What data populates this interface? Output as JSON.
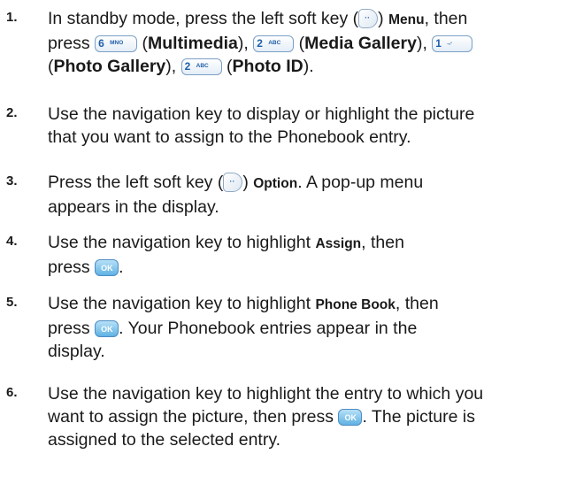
{
  "steps": [
    {
      "num": "1.",
      "t1": "In standby mode, press the left soft key (",
      "t2": ") ",
      "menu": "Menu",
      "t3": ", then",
      "t4": "press",
      "multimedia": "Multimedia",
      "media_gallery": "Media Gallery",
      "photo_gallery": "Photo Gallery",
      "photo_id": "Photo ID",
      "t5": ")."
    },
    {
      "num": "2.",
      "line1": "Use the navigation key to display or highlight the picture",
      "line2": "that you want to assign to the Phonebook entry."
    },
    {
      "num": "3.",
      "t1": "Press the left soft key (",
      "t2": ") ",
      "option": "Option",
      "t3": ". A pop-up menu",
      "line2": "appears in the display."
    },
    {
      "num": "4.",
      "t1": "Use the navigation key to highlight ",
      "assign": "Assign",
      "t2": ", then",
      "t3": "press",
      "t4": "."
    },
    {
      "num": "5.",
      "t1": "Use the navigation key to highlight ",
      "phone_book": "Phone Book",
      "t2": ", then",
      "t3": "press",
      "t4": ". Your Phonebook entries appear in the",
      "line3": "display."
    },
    {
      "num": "6.",
      "line1": "Use the navigation key to highlight the entry to which you",
      "t1": "want to assign the picture, then press",
      "t2": ". The picture is",
      "line3": "assigned to the selected entry."
    }
  ],
  "keys": {
    "k6_digit": "6",
    "k6_letters": "MNO",
    "k2_digit": "2",
    "k2_letters": "ABC",
    "k1_digit": "1",
    "k1_letters": ".,-",
    "soft_glyph": "··",
    "ok_label": "OK"
  }
}
